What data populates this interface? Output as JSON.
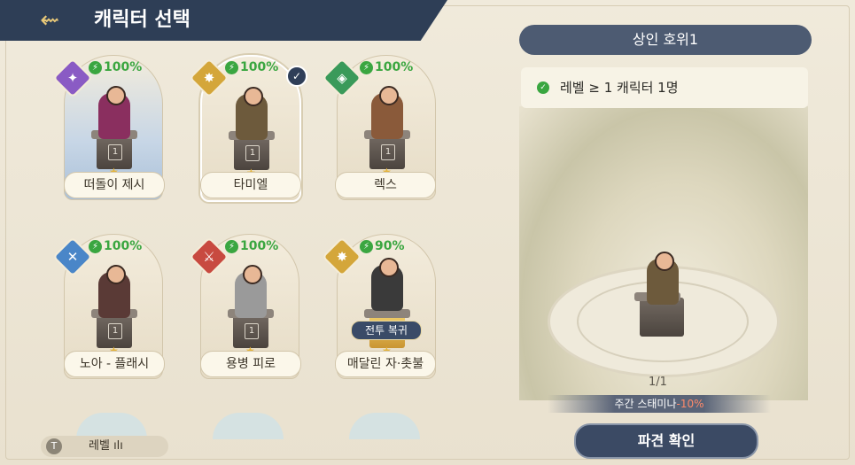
{
  "header": {
    "title": "캐릭터 선택",
    "back_icon": "winged-back-icon"
  },
  "characters": [
    {
      "name": "떠돌이 제시",
      "stamina": "100%",
      "level": "1",
      "element": "purple",
      "selected": false
    },
    {
      "name": "타미엘",
      "stamina": "100%",
      "level": "1",
      "element": "gold",
      "selected": true
    },
    {
      "name": "렉스",
      "stamina": "100%",
      "level": "1",
      "element": "green",
      "selected": false
    },
    {
      "name": "노아 - 플래시",
      "stamina": "100%",
      "level": "1",
      "element": "blue",
      "selected": false
    },
    {
      "name": "용병 피로",
      "stamina": "100%",
      "level": "1",
      "element": "red",
      "selected": false
    },
    {
      "name": "매달린 자·촛불",
      "stamina": "90%",
      "level": "",
      "element": "gold",
      "selected": false,
      "badge": "전투 복귀"
    }
  ],
  "filter": {
    "icon": "T",
    "label": "레벨"
  },
  "mission": {
    "title": "상인 호위1",
    "requirement": "레벨 ≥ 1 캐릭터 1명",
    "count": "1/1",
    "weekly_label": "주간 스태미나",
    "weekly_value": "-10%",
    "dispatch_label": "파견 확인"
  }
}
